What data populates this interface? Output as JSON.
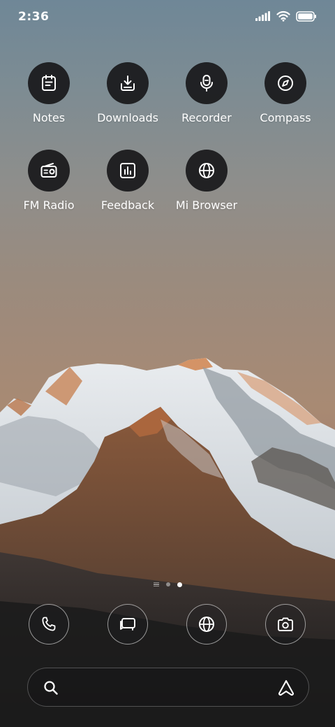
{
  "status_bar": {
    "time": "2:36",
    "icons": [
      "signal-icon",
      "wifi-icon",
      "battery-icon"
    ]
  },
  "apps": [
    {
      "label": "Notes",
      "icon": "notes-icon"
    },
    {
      "label": "Downloads",
      "icon": "download-icon"
    },
    {
      "label": "Recorder",
      "icon": "microphone-icon"
    },
    {
      "label": "Compass",
      "icon": "compass-icon"
    },
    {
      "label": "FM Radio",
      "icon": "radio-icon"
    },
    {
      "label": "Feedback",
      "icon": "feedback-chart-icon"
    },
    {
      "label": "Mi Browser",
      "icon": "globe-icon"
    }
  ],
  "page_indicator": {
    "pages": 3,
    "active_index": 2,
    "first_is_list": true
  },
  "dock": [
    {
      "icon": "phone-icon"
    },
    {
      "icon": "messages-icon"
    },
    {
      "icon": "globe-icon"
    },
    {
      "icon": "camera-icon"
    }
  ],
  "search_bar": {
    "icons": [
      "search-icon",
      "assistant-icon"
    ]
  },
  "colors": {
    "icon_bg": "#18181a",
    "label": "#ffffff"
  }
}
